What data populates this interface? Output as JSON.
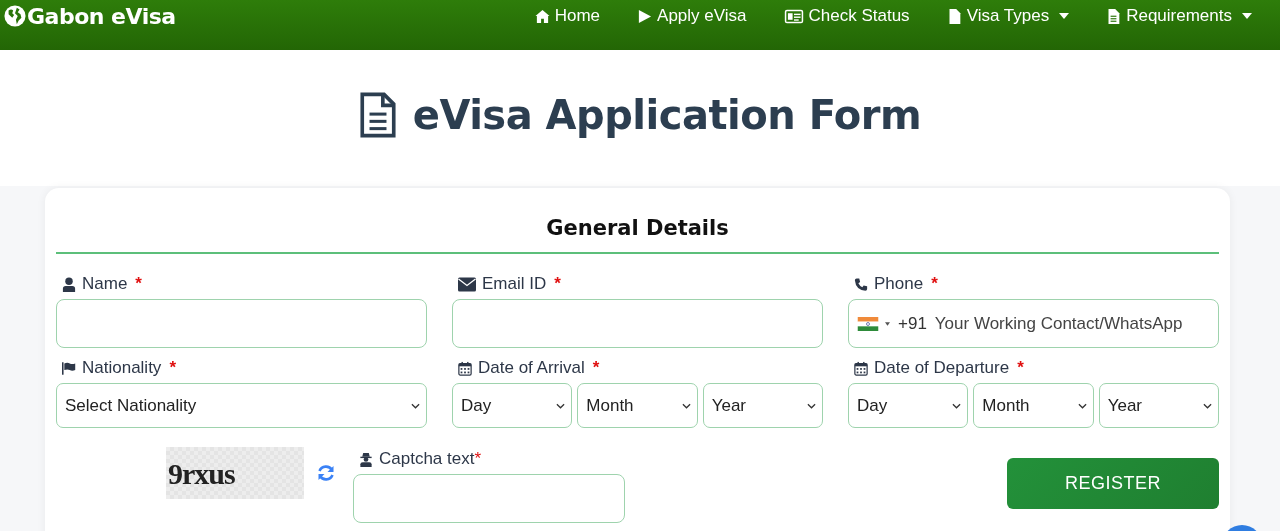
{
  "navbar": {
    "brand": "Gabon eVisa",
    "items": [
      {
        "label": "Home",
        "dropdown": false
      },
      {
        "label": "Apply eVisa",
        "dropdown": false
      },
      {
        "label": "Check Status",
        "dropdown": false
      },
      {
        "label": "Visa Types",
        "dropdown": true
      },
      {
        "label": "Requirements",
        "dropdown": true
      }
    ]
  },
  "page_title": "eVisa Application Form",
  "form": {
    "section_title": "General Details",
    "fields": [
      {
        "kind": "text",
        "label": "Name",
        "required_mark": "*"
      },
      {
        "kind": "text",
        "label": "Email ID",
        "required_mark": "*"
      },
      {
        "kind": "phone",
        "label": "Phone",
        "required_mark": "*",
        "dial_code": "+91",
        "placeholder": "Your Working Contact/WhatsApp"
      },
      {
        "kind": "select",
        "label": "Nationality",
        "required_mark": "*",
        "options_shown": [
          "Select Nationality"
        ]
      },
      {
        "kind": "select",
        "label": "Date of Arrival",
        "required_mark": "*",
        "options_shown": [
          "Day",
          "Month",
          "Year"
        ]
      },
      {
        "kind": "select",
        "label": "Date of Departure",
        "required_mark": "*",
        "options_shown": [
          "Day",
          "Month",
          "Year"
        ]
      }
    ],
    "captcha": {
      "image_text": "9rxus",
      "label": "Captcha text",
      "required_mark": "*"
    },
    "submit": "REGISTER"
  }
}
